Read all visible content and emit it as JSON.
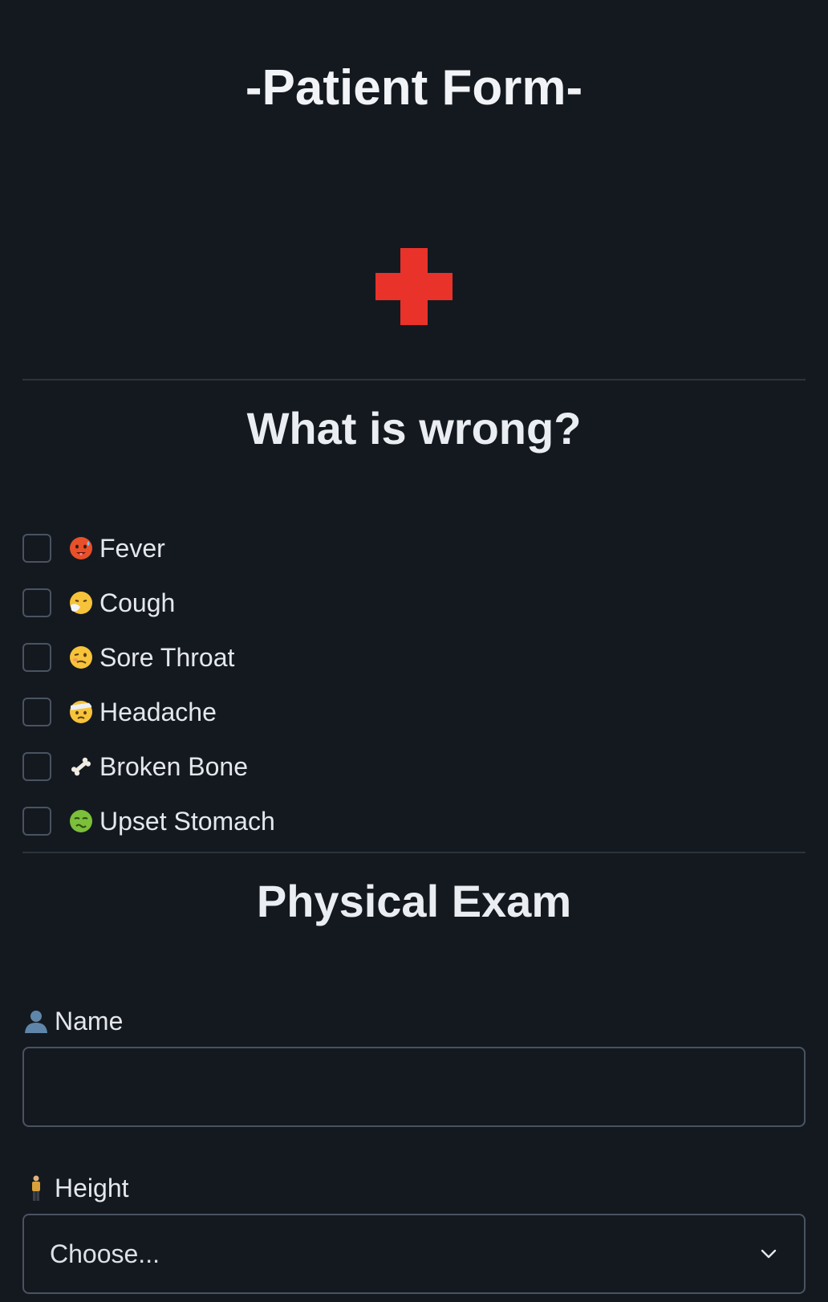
{
  "header": {
    "title": "-Patient Form-",
    "logo_icon": "red-cross-icon",
    "logo_color": "#e8322a"
  },
  "symptoms": {
    "title": "What is wrong?",
    "items": [
      {
        "label": "Fever",
        "icon": "hot-face-icon",
        "checked": false
      },
      {
        "label": "Cough",
        "icon": "sneezing-face-icon",
        "checked": false
      },
      {
        "label": "Sore Throat",
        "icon": "woozy-face-icon",
        "checked": false
      },
      {
        "label": "Headache",
        "icon": "bandaged-head-face-icon",
        "checked": false
      },
      {
        "label": "Broken Bone",
        "icon": "bone-icon",
        "checked": false
      },
      {
        "label": "Upset Stomach",
        "icon": "nauseated-face-icon",
        "checked": false
      }
    ]
  },
  "exam": {
    "title": "Physical Exam",
    "name_label": "Name",
    "name_icon": "person-silhouette-icon",
    "name_value": "",
    "height_label": "Height",
    "height_icon": "standing-person-icon",
    "height_selected": "Choose..."
  },
  "colors": {
    "background": "#141920",
    "border": "#4a5360",
    "text": "#e4e7eb"
  }
}
